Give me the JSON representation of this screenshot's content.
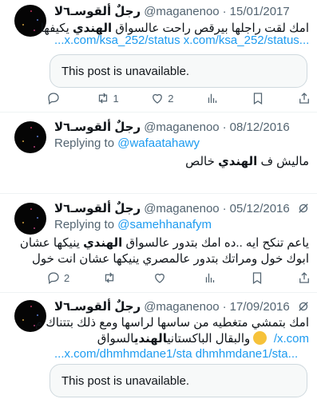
{
  "tweets": [
    {
      "name": "رجلٌ ألقوسـ٦لا",
      "handle": "@maganenoo",
      "date": "15/01/2017",
      "text_a": "امك لقت راجلها بيرقص راحت عالسواق ",
      "text_bold": "الهندي",
      "text_b": " يكيفها",
      "links": "...x.com/ksa_252/status x.com/ksa_252/status...",
      "unavailable": "This post is unavailable.",
      "reply_count": "",
      "retweet_count": "1",
      "like_count": "2"
    },
    {
      "name": "رجلٌ ألقوسـ٦لا",
      "handle": "@maganenoo",
      "date": "08/12/2016",
      "replying_prefix": "Replying to ",
      "replying_to": "@wafaatahawy",
      "text_a": "ماليش ف ",
      "text_bold": "الهندي",
      "text_b": " خالص"
    },
    {
      "name": "رجلٌ ألقوسـ٦لا",
      "handle": "@maganenoo",
      "date": "05/12/2016",
      "replying_prefix": "Replying to ",
      "replying_to": "@samehhanafym",
      "line1_a": "ياعم تنكح ايه ..ده امك بتدور عالسواق ",
      "line1_bold": "الهندي",
      "line1_b": " ينيكها عشان",
      "line2": "ابوك خول ومراتك بتدور عالمصري ينيكها عشان انت خول",
      "reply_count": "2",
      "retweet_count": "",
      "like_count": ""
    },
    {
      "name": "رجلٌ ألقوسـ٦لا",
      "handle": "@maganenoo",
      "date": "17/09/2016",
      "line1": "امك بتمشي متغطيه من ساسها لراسها ومع ذلك بتتناك م",
      "line2_a": "السواق ",
      "line2_bold": "الهندي",
      "line2_b": " والبقال الباكستاني",
      "line2_link": "x.com/",
      "links": "...x.com/dhmhmdane1/sta dhmhmdane1/sta...",
      "unavailable": "This post is unavailable."
    }
  ],
  "colors": {
    "accent": "#1d9bf0",
    "muted": "#536471",
    "border": "#cfd9de"
  },
  "icons": [
    "reply-icon",
    "retweet-icon",
    "like-icon",
    "views-icon",
    "bookmark-icon",
    "share-icon",
    "grok-icon",
    "emoji-smile-icon"
  ]
}
